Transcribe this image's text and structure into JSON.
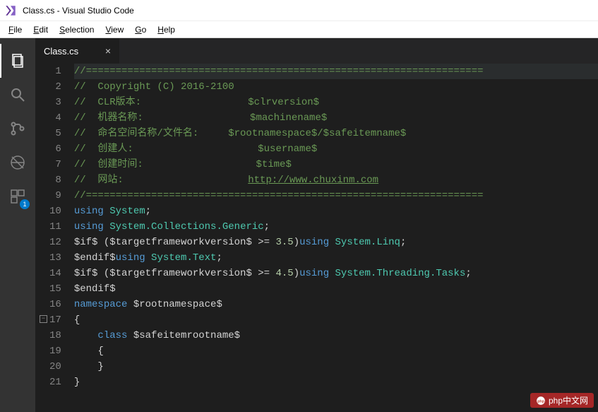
{
  "window": {
    "title": "Class.cs - Visual Studio Code"
  },
  "menu": {
    "file": "File",
    "edit": "Edit",
    "selection": "Selection",
    "view": "View",
    "go": "Go",
    "help": "Help"
  },
  "activitybar": {
    "explorer": "explorer",
    "search": "search",
    "scm": "scm",
    "debug": "debug",
    "extensions": "extensions",
    "extensions_badge": "1"
  },
  "tab": {
    "label": "Class.cs",
    "close": "×"
  },
  "code": {
    "lines": [
      "//===================================================================",
      "//  Copyright (C) 2016-2100",
      "//  CLR版本:                  $clrversion$",
      "//  机器名称:                  $machinename$",
      "//  命名空间名称/文件名:     $rootnamespace$/$safeitemname$",
      "//  创建人:                     $username$",
      "//  创建时间:                   $time$",
      "//  网站:                     http://www.chuxinm.com",
      "//===================================================================",
      "using System;",
      "using System.Collections.Generic;",
      "$if$ ($targetframeworkversion$ >= 3.5)using System.Linq;",
      "$endif$using System.Text;",
      "$if$ ($targetframeworkversion$ >= 4.5)using System.Threading.Tasks;",
      "$endif$",
      "namespace $rootnamespace$",
      "{",
      "    class $safeitemrootname$",
      "    {",
      "    }",
      "}"
    ],
    "link_text": "http://www.chuxinm.com",
    "fold_glyph": "−"
  },
  "watermark": {
    "text": "php中文网"
  }
}
